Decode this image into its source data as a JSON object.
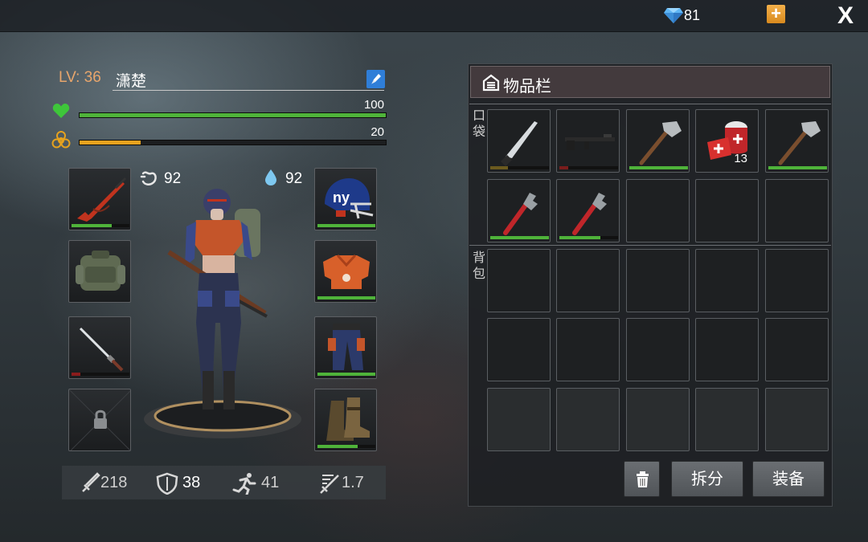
{
  "topbar": {
    "gems": "81"
  },
  "profile": {
    "level_label": "LV: 36",
    "name": "潇楚"
  },
  "health": {
    "value": "100",
    "fraction": 1.0,
    "color": "#4fb33a"
  },
  "radiation": {
    "value": "20",
    "fraction": 0.2,
    "color": "#e6a21e"
  },
  "vitals": {
    "hunger": "92",
    "thirst": "92"
  },
  "equipment": [
    {
      "slot": "weapon-rifle",
      "durability": 0.7,
      "dur_color": "#4fb33a"
    },
    {
      "slot": "backpack",
      "durability": null
    },
    {
      "slot": "melee-katana",
      "durability": 0.15,
      "dur_color": "#8a1c1c"
    },
    {
      "slot": "locked",
      "durability": null
    },
    {
      "slot": "helmet",
      "durability": 1.0,
      "dur_color": "#4fb33a"
    },
    {
      "slot": "chest-armor",
      "durability": 1.0,
      "dur_color": "#4fb33a"
    },
    {
      "slot": "pants",
      "durability": 1.0,
      "dur_color": "#4fb33a"
    },
    {
      "slot": "boots",
      "durability": 0.7,
      "dur_color": "#4fb33a"
    }
  ],
  "stats": {
    "attack": "218",
    "defense": "38",
    "speed": "41",
    "attack_speed": "1.7"
  },
  "inventory": {
    "title": "物品栏",
    "pocket_label": "口袋",
    "backpack_label": "背包",
    "pocket_items": [
      {
        "name": "machete",
        "durability": 0.3,
        "dur_color": "#6b5a1e"
      },
      {
        "name": "rifle",
        "durability": 0.15,
        "dur_color": "#7a1c1c"
      },
      {
        "name": "stone-axe",
        "durability": 1.0,
        "dur_color": "#4fb33a"
      },
      {
        "name": "bandage",
        "durability": null,
        "quantity": "13"
      },
      {
        "name": "stone-axe",
        "durability": 1.0,
        "dur_color": "#4fb33a"
      },
      {
        "name": "pipe-wrench",
        "durability": 1.0,
        "dur_color": "#4fb33a"
      },
      {
        "name": "pipe-wrench",
        "durability": 0.7,
        "dur_color": "#4fb33a"
      }
    ],
    "buttons": {
      "split": "拆分",
      "equip": "装备"
    }
  }
}
